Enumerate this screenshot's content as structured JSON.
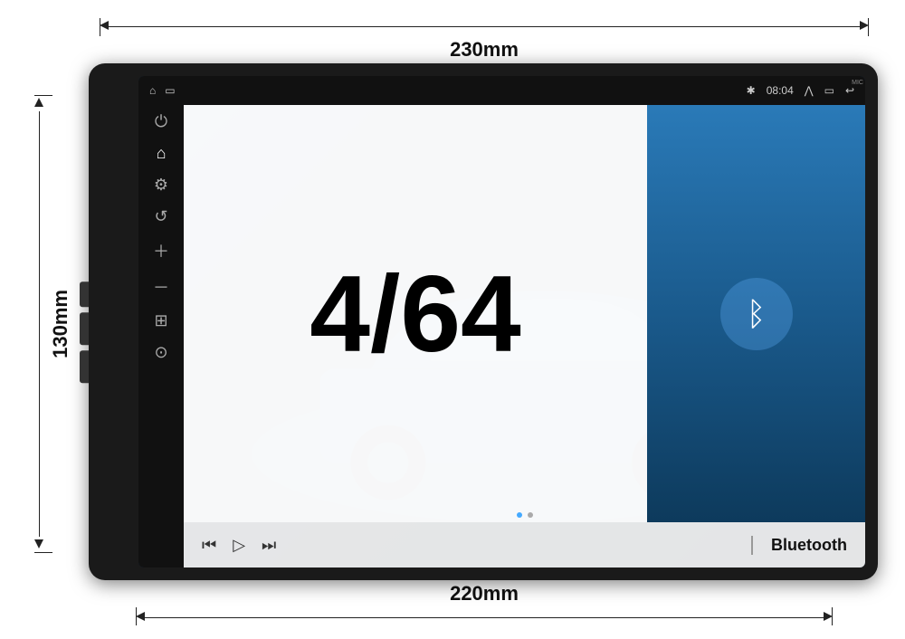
{
  "dimensions": {
    "top": "230mm",
    "bottom": "220mm",
    "left": "130mm"
  },
  "device": {
    "screen": {
      "status_bar": {
        "left_icons": [
          "home",
          "window"
        ],
        "right_icons": [
          "bluetooth",
          "time",
          "chevron-up",
          "window-icon",
          "back"
        ],
        "time": "08:04"
      },
      "sidebar": {
        "icons": [
          "power",
          "home",
          "back",
          "volume-up",
          "volume-down",
          "grid",
          "navigation"
        ]
      },
      "main": {
        "big_label": "4/64",
        "bluetooth_text": "Bluetooth",
        "media_controls": {
          "rewind": "⏮",
          "play": "▷",
          "forward": "⏭"
        }
      }
    }
  }
}
